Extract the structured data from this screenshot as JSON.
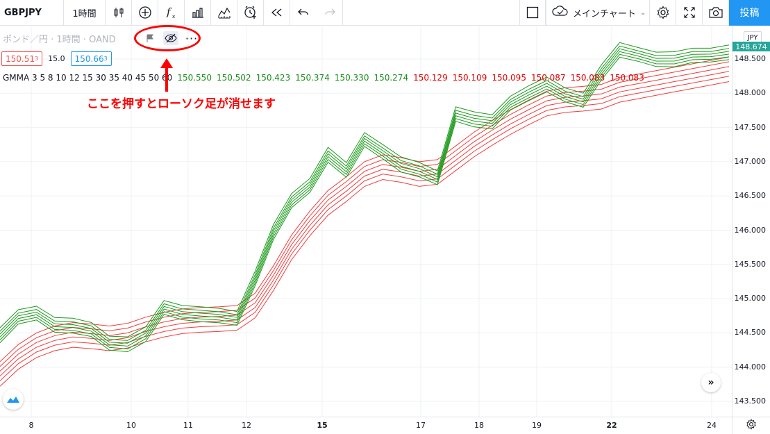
{
  "toolbar": {
    "symbol": "GBPJPY",
    "interval": "1時間",
    "layout_name": "メインチャート",
    "publish_label": "投稿",
    "icons": [
      "candles-icon",
      "add-compare-icon",
      "indicators-icon",
      "templates-icon",
      "compare-icon",
      "alert-icon",
      "replay-icon",
      "undo-icon",
      "redo-icon",
      "fullscreen-rect-icon",
      "cloud-icon",
      "settings-icon",
      "fullscreen-icon",
      "snapshot-icon"
    ]
  },
  "legend": {
    "title": "ポンド／円 · 1時間 · OAND",
    "bid": "150.51",
    "bid_sup": "3",
    "spread": "15.0",
    "ask": "150.66",
    "ask_sup": "3",
    "gmma_label": "GMMA 3 5 8 10 12 15 30 35 40 45 50 60",
    "gmma_short_values": [
      "150.550",
      "150.502",
      "150.423",
      "150.374",
      "150.330",
      "150.274"
    ],
    "gmma_long_values": [
      "150.129",
      "150.109",
      "150.095",
      "150.087",
      "150.083",
      "150.083"
    ]
  },
  "annotation": "ここを押すとローソク足が消せます",
  "price_axis": {
    "currency": "JPY",
    "last_price": "148.674",
    "labels": [
      "148.500",
      "148.000",
      "147.500",
      "147.000",
      "146.500",
      "146.000",
      "145.500",
      "145.000",
      "144.500",
      "144.000",
      "143.500"
    ]
  },
  "time_axis": {
    "labels": [
      {
        "text": "8",
        "bold": false
      },
      {
        "text": "10",
        "bold": false
      },
      {
        "text": "11",
        "bold": false
      },
      {
        "text": "12",
        "bold": false
      },
      {
        "text": "15",
        "bold": true
      },
      {
        "text": "17",
        "bold": false
      },
      {
        "text": "18",
        "bold": false
      },
      {
        "text": "19",
        "bold": false
      },
      {
        "text": "22",
        "bold": true
      },
      {
        "text": "24",
        "bold": false
      }
    ]
  },
  "colors": {
    "short_ma": "#1a9a1a",
    "long_ma": "#f23c3c",
    "accent": "#2196f3",
    "annotation": "#ff0000",
    "grid": "#eef0f3"
  },
  "chart_data": {
    "type": "line",
    "title": "",
    "xlabel": "",
    "ylabel": "",
    "ylim": [
      143.3,
      148.8
    ],
    "x": [
      0,
      1,
      2,
      3,
      4,
      5,
      6,
      7,
      8,
      9,
      10,
      11,
      12,
      13,
      14,
      15,
      16,
      17,
      18,
      19,
      20,
      21,
      22,
      23,
      24,
      25,
      26,
      27,
      28,
      29,
      30,
      31,
      32,
      33,
      34,
      35,
      36,
      37,
      38,
      39,
      40
    ],
    "short_group_center": [
      144.45,
      144.7,
      144.78,
      144.62,
      144.58,
      144.52,
      144.35,
      144.33,
      144.45,
      144.85,
      144.8,
      144.76,
      144.72,
      144.7,
      145.3,
      145.95,
      146.4,
      146.65,
      147.1,
      146.85,
      147.3,
      147.15,
      146.95,
      146.85,
      146.75,
      147.7,
      147.6,
      147.55,
      147.85,
      148.0,
      148.1,
      147.95,
      147.9,
      148.3,
      148.6,
      148.55,
      148.5,
      148.48,
      148.52,
      148.55,
      148.6
    ],
    "long_group_center": [
      143.9,
      144.15,
      144.32,
      144.42,
      144.47,
      144.45,
      144.42,
      144.46,
      144.55,
      144.62,
      144.67,
      144.69,
      144.7,
      144.72,
      144.9,
      145.3,
      145.75,
      146.1,
      146.4,
      146.6,
      146.82,
      146.92,
      146.88,
      146.82,
      146.85,
      147.05,
      147.25,
      147.42,
      147.58,
      147.72,
      147.85,
      147.9,
      147.92,
      147.95,
      148.05,
      148.1,
      148.15,
      148.2,
      148.25,
      148.3,
      148.35
    ],
    "series": [
      {
        "name": "GMMA short",
        "periods": [
          3,
          5,
          8,
          10,
          12,
          15
        ]
      },
      {
        "name": "GMMA long",
        "periods": [
          30,
          35,
          40,
          45,
          50,
          60
        ]
      }
    ]
  }
}
